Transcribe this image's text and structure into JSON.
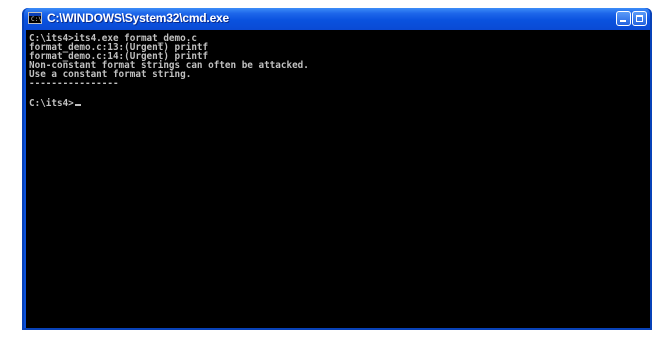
{
  "window": {
    "title": "C:\\WINDOWS\\System32\\cmd.exe",
    "icon": "cmd-icon",
    "icon_text": "C:\\",
    "buttons": [
      "minimize-icon",
      "maximize-icon"
    ]
  },
  "console": {
    "lines": [
      "C:\\its4>its4.exe format_demo.c",
      "format_demo.c:13:(Urgent) printf",
      "format_demo.c:14:(Urgent) printf",
      "Non-constant format strings can often be attacked.",
      "Use a constant format string.",
      "----------------",
      "",
      "C:\\its4>"
    ]
  },
  "colors": {
    "titlebar": "#0a52df",
    "console_bg": "#000000",
    "console_text": "#c0c0c0"
  }
}
